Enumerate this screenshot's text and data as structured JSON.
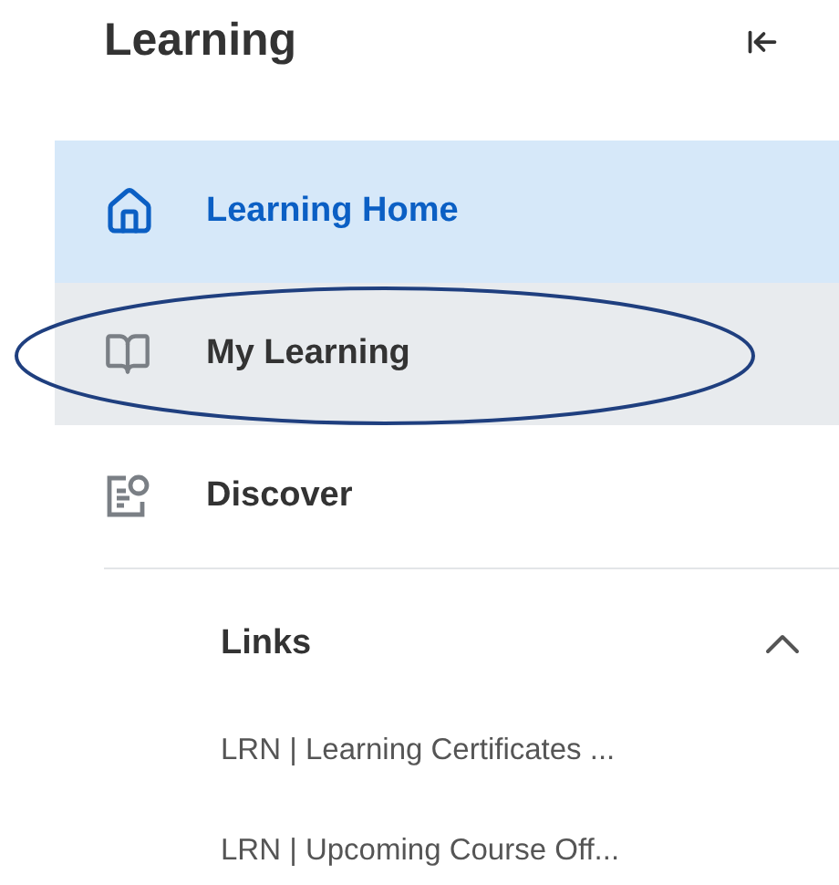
{
  "header": {
    "title": "Learning"
  },
  "nav_items": [
    {
      "label": "Learning Home",
      "kind": "home",
      "selected": true,
      "highlighted": false,
      "circled": false
    },
    {
      "label": "My Learning",
      "kind": "book",
      "selected": false,
      "highlighted": true,
      "circled": true
    },
    {
      "label": "Discover",
      "kind": "discover",
      "selected": false,
      "highlighted": false,
      "circled": false
    }
  ],
  "links": {
    "title": "Links",
    "expanded": true,
    "items": [
      "LRN | Learning Certificates ...",
      "LRN | Upcoming Course Off..."
    ]
  }
}
